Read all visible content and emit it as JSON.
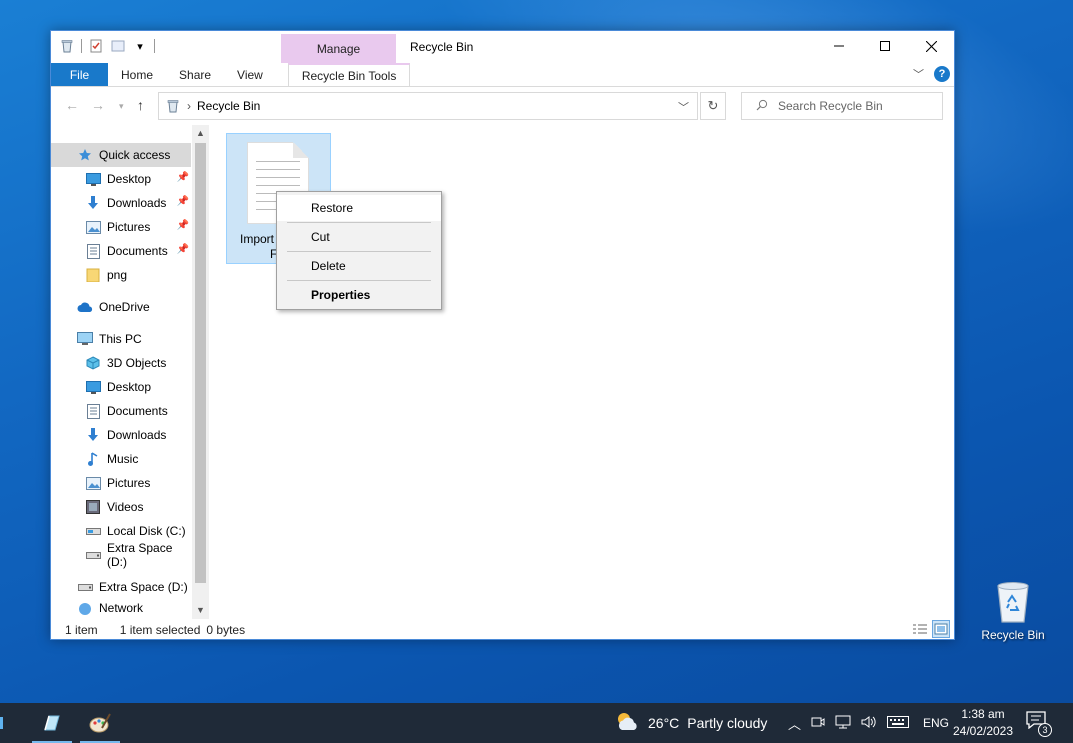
{
  "window": {
    "title": "Recycle Bin",
    "manage_tab": "Manage",
    "tabs": [
      "File",
      "Home",
      "Share",
      "View",
      "Recycle Bin Tools"
    ]
  },
  "address": {
    "path": "Recycle Bin",
    "search_placeholder": "Search Recycle Bin"
  },
  "navpane": {
    "quick_access": "Quick access",
    "quick_items": [
      {
        "label": "Desktop",
        "icon": "desktop-icon",
        "pinned": true
      },
      {
        "label": "Downloads",
        "icon": "download-icon",
        "pinned": true
      },
      {
        "label": "Pictures",
        "icon": "pictures-icon",
        "pinned": true
      },
      {
        "label": "Documents",
        "icon": "documents-icon",
        "pinned": true
      },
      {
        "label": "png",
        "icon": "folder-icon",
        "pinned": false
      }
    ],
    "onedrive": "OneDrive",
    "this_pc": "This PC",
    "pc_items": [
      {
        "label": "3D Objects",
        "icon": "3d-objects-icon"
      },
      {
        "label": "Desktop",
        "icon": "desktop-icon"
      },
      {
        "label": "Documents",
        "icon": "documents-icon"
      },
      {
        "label": "Downloads",
        "icon": "download-icon"
      },
      {
        "label": "Music",
        "icon": "music-icon"
      },
      {
        "label": "Pictures",
        "icon": "pictures-icon"
      },
      {
        "label": "Videos",
        "icon": "videos-icon"
      },
      {
        "label": "Local Disk (C:)",
        "icon": "drive-icon"
      },
      {
        "label": "Extra Space (D:)",
        "icon": "drive-icon"
      }
    ],
    "extra_drive": "Extra Space (D:)",
    "network": "Network"
  },
  "content": {
    "file_name_line1": "Import",
    "file_name_line2": "F"
  },
  "context_menu": {
    "items": [
      "Restore",
      "Cut",
      "Delete",
      "Properties"
    ]
  },
  "statusbar": {
    "count": "1 item",
    "selected": "1 item selected",
    "size": "0 bytes"
  },
  "desktop": {
    "recycle_bin_label": "Recycle Bin"
  },
  "taskbar": {
    "temperature": "26°C",
    "weather": "Partly cloudy",
    "language": "ENG",
    "time": "1:38 am",
    "date": "24/02/2023",
    "notification_count": "3"
  },
  "colors": {
    "accent": "#1979ca",
    "manage_tab": "#e9c9ee",
    "selection": "#cce4f7",
    "taskbar": "#1f2a38"
  }
}
